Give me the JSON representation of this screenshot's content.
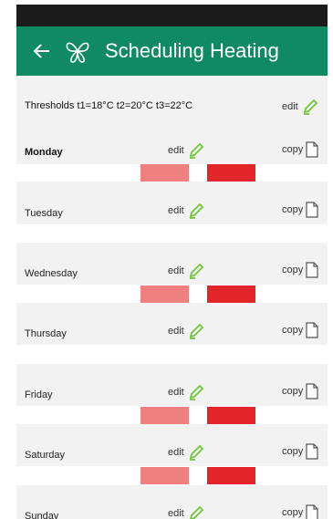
{
  "header": {
    "title": "Scheduling Heating"
  },
  "thresholds": {
    "text": "Thresholds t1=18°C t2=20°C t3=22°C",
    "edit_label": "edit"
  },
  "days": [
    {
      "name": "Monday",
      "edit_label": "edit",
      "copy_label": "copy",
      "has_schedule": true
    },
    {
      "name": "Tuesday",
      "edit_label": "edit",
      "copy_label": "copy",
      "has_schedule": false
    },
    {
      "name": "Wednesday",
      "edit_label": "edit",
      "copy_label": "copy",
      "has_schedule": true
    },
    {
      "name": "Thursday",
      "edit_label": "edit",
      "copy_label": "copy",
      "has_schedule": false
    },
    {
      "name": "Friday",
      "edit_label": "edit",
      "copy_label": "copy",
      "has_schedule": true
    },
    {
      "name": "Saturday",
      "edit_label": "edit",
      "copy_label": "copy",
      "has_schedule": true
    },
    {
      "name": "Sunday",
      "edit_label": "edit",
      "copy_label": "copy",
      "has_schedule": false
    }
  ],
  "colors": {
    "accent": "#0f8a63",
    "t2": "#f08080",
    "t3": "#e3242b",
    "pencil": "#6ec83a"
  }
}
